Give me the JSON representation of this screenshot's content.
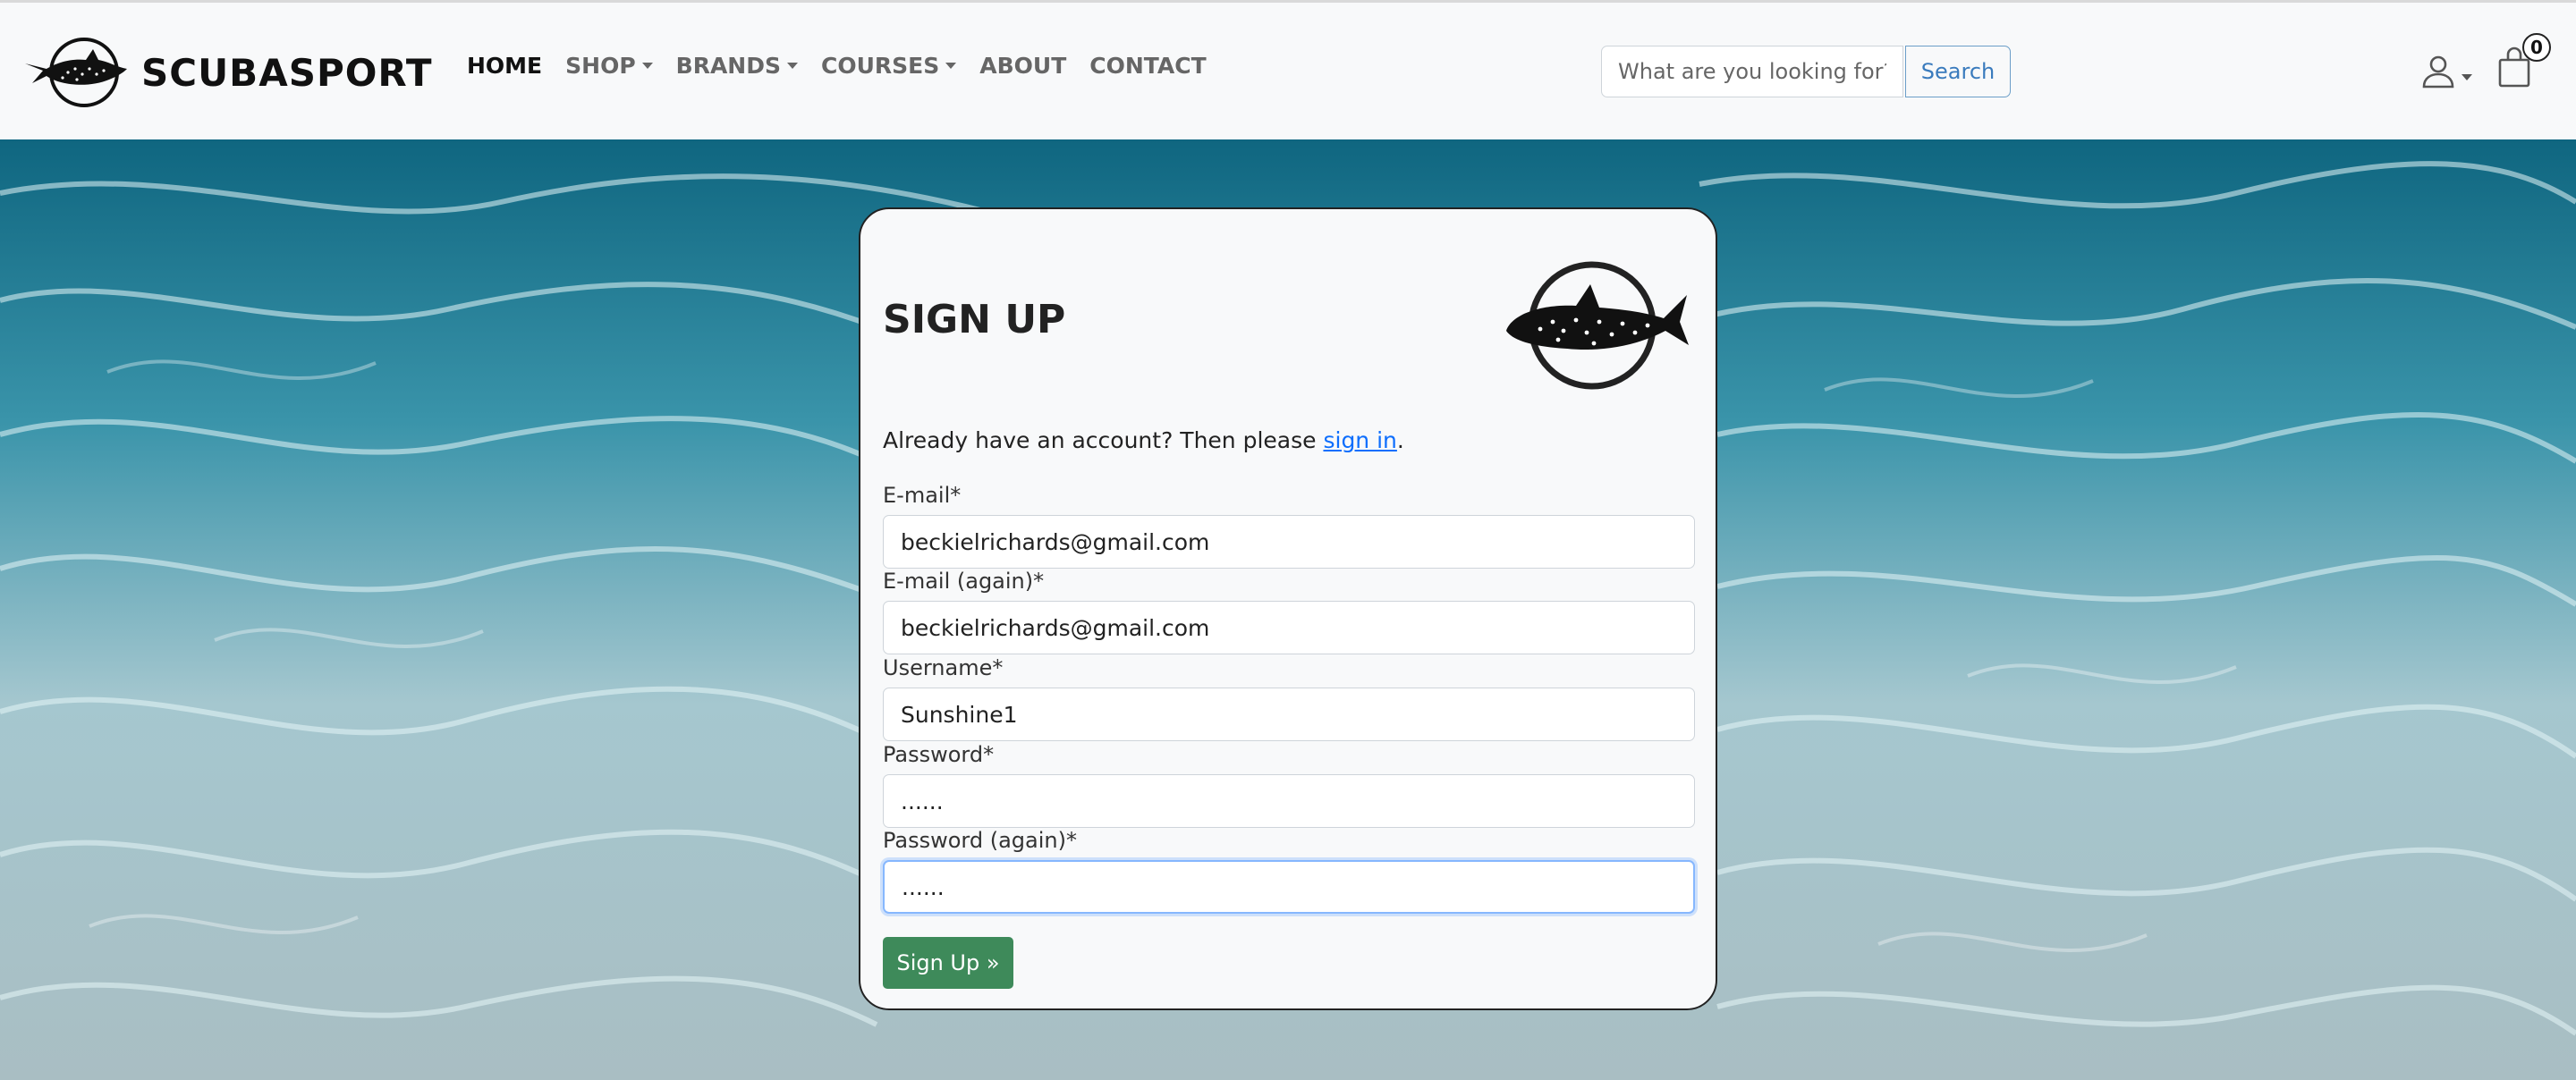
{
  "brand": {
    "name": "SCUBASPORT"
  },
  "nav": {
    "items": [
      {
        "label": "HOME",
        "active": true,
        "dropdown": false
      },
      {
        "label": "SHOP",
        "dropdown": true
      },
      {
        "label": "BRANDS",
        "dropdown": true
      },
      {
        "label": "COURSES",
        "dropdown": true
      },
      {
        "label": "ABOUT",
        "dropdown": false
      },
      {
        "label": "CONTACT",
        "dropdown": false
      }
    ]
  },
  "search": {
    "placeholder": "What are you looking for?",
    "button_label": "Search"
  },
  "cart": {
    "count": "0"
  },
  "form": {
    "title": "SIGN UP",
    "already_text": "Already have an account? Then please ",
    "signin_link": "sign in",
    "signin_suffix": ".",
    "fields": [
      {
        "label": "E-mail*",
        "value": "beckielrichards@gmail.com"
      },
      {
        "label": "E-mail (again)*",
        "value": "beckielrichards@gmail.com"
      },
      {
        "label": "Username*",
        "value": "Sunshine1"
      },
      {
        "label": "Password*",
        "value": "......"
      },
      {
        "label": "Password (again)*",
        "value": "......"
      }
    ],
    "submit_label": "Sign Up »"
  },
  "colors": {
    "submit_bg": "#3e8a5a",
    "link": "#0d6efd",
    "search_button_text": "#3a7bbd"
  },
  "icons": [
    "whale-shark-logo-icon",
    "user-icon",
    "shopping-bag-icon",
    "caret-down-icon"
  ]
}
